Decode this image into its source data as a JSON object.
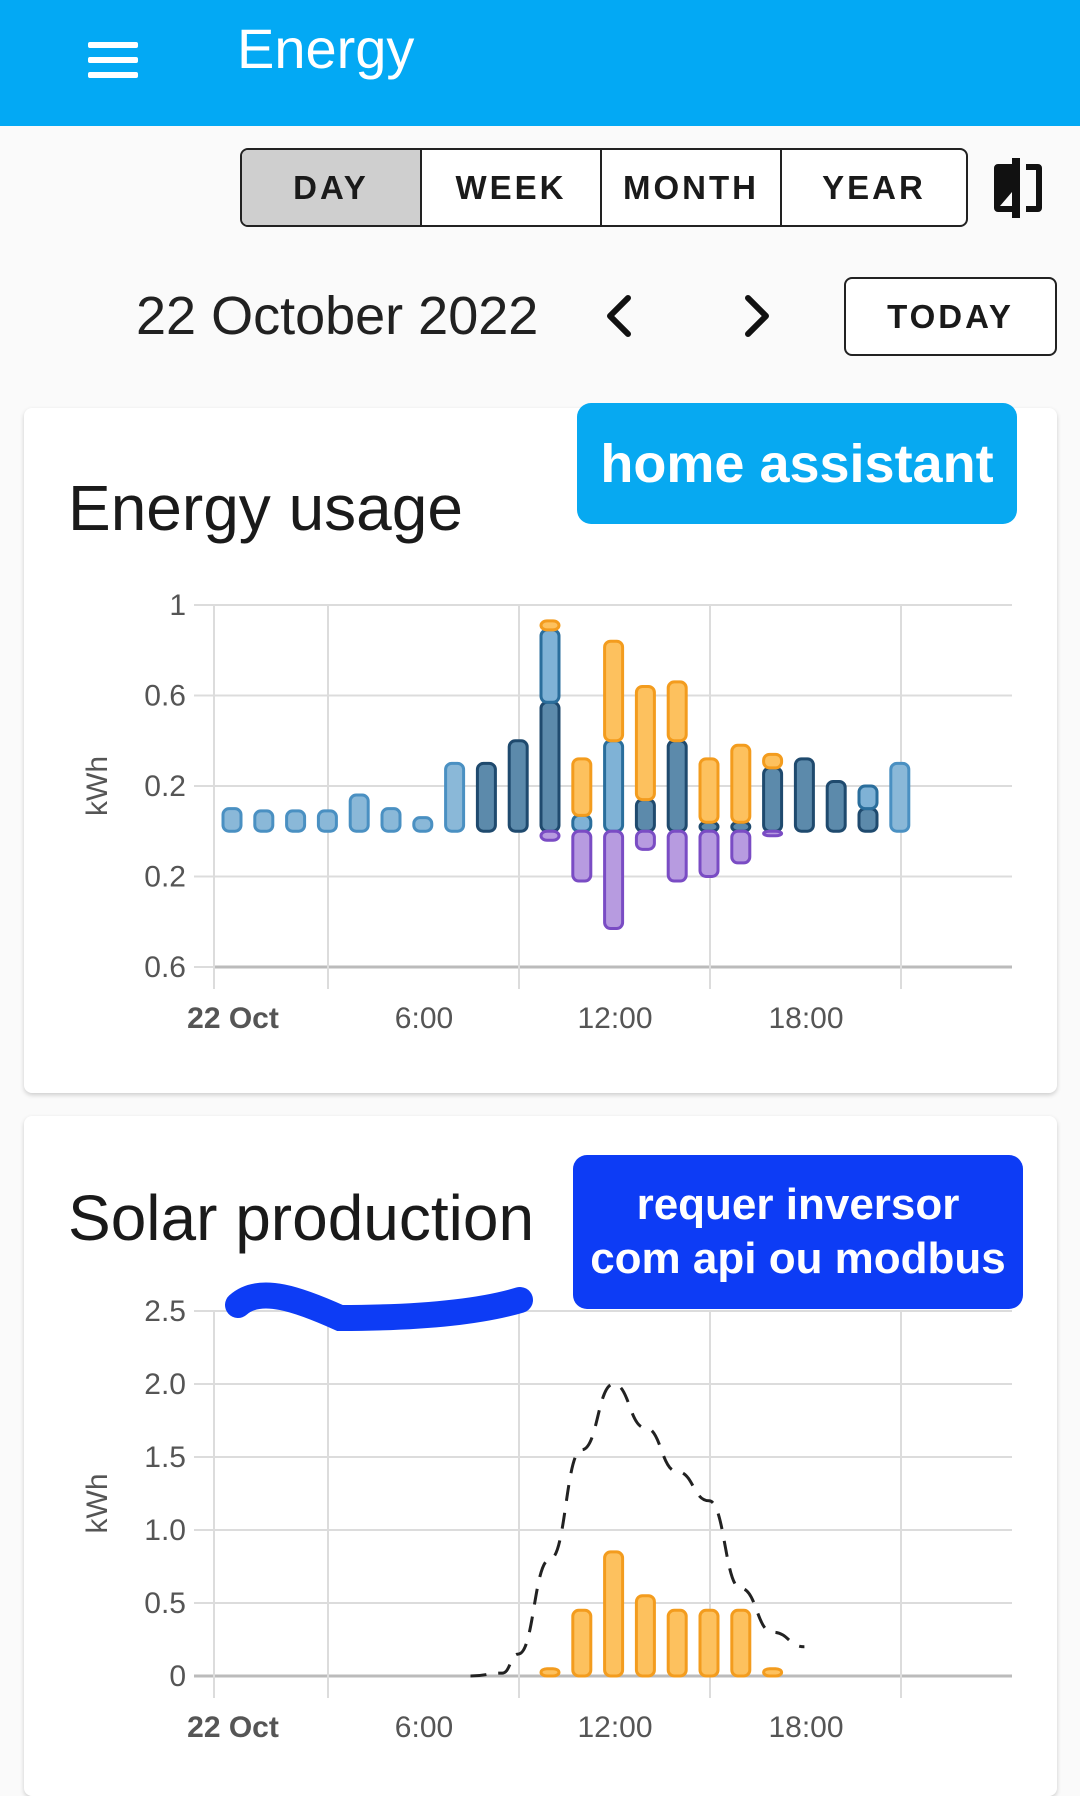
{
  "appbar": {
    "title": "Energy",
    "menu_icon": "menu-icon",
    "color": "#03a9f4"
  },
  "period_selector": {
    "options": [
      "DAY",
      "WEEK",
      "MONTH",
      "YEAR"
    ],
    "selected": "DAY",
    "compare_icon": "compare-icon"
  },
  "date_nav": {
    "date": "22 October 2022",
    "prev_icon": "chevron-left-icon",
    "next_icon": "chevron-right-icon",
    "today_label": "TODAY"
  },
  "annotations": {
    "sticker1": "home assistant",
    "sticker2_line1": "requer inversor",
    "sticker2_line2": "com api ou modbus"
  },
  "cards": {
    "usage_title": "Energy usage",
    "solar_title": "Solar production"
  },
  "chart_data": [
    {
      "type": "bar",
      "title": "Energy usage",
      "ylabel": "kWh",
      "y_tick_labels": [
        "1",
        "0.6",
        "0.2",
        "0.2",
        "0.6"
      ],
      "x_tick_labels": [
        "22 Oct",
        "6:00",
        "12:00",
        "18:00"
      ],
      "ylim": [
        -0.6,
        1.0
      ],
      "grid": true,
      "categories": [
        "0:00",
        "1:00",
        "2:00",
        "3:00",
        "4:00",
        "5:00",
        "6:00",
        "7:00",
        "8:00",
        "9:00",
        "10:00",
        "11:00",
        "12:00",
        "13:00",
        "14:00",
        "15:00",
        "16:00",
        "17:00",
        "18:00",
        "19:00",
        "20:00",
        "21:00"
      ],
      "series": [
        {
          "color": "#8ab8d8",
          "stroke": "#4a90c2",
          "values": [
            0.1,
            0.09,
            0.09,
            0.09,
            0.16,
            0.1,
            0.06,
            0.3,
            0,
            0,
            0,
            0,
            0,
            0,
            0,
            0,
            0,
            0,
            0,
            0,
            0,
            0.3
          ]
        },
        {
          "color": "#5c8aab",
          "stroke": "#1f4a6e",
          "values": [
            0,
            0,
            0,
            0,
            0,
            0,
            0,
            0,
            0.3,
            0.4,
            0.57,
            0,
            0,
            0.14,
            0.4,
            0.04,
            0.04,
            0.28,
            0.32,
            0.22,
            0.1,
            0
          ]
        },
        {
          "color": "#7fb2d6",
          "stroke": "#2a6e9c",
          "values": [
            0,
            0,
            0,
            0,
            0,
            0,
            0,
            0,
            0,
            0,
            0.32,
            0.07,
            0.4,
            0,
            0,
            0,
            0,
            0,
            0,
            0,
            0.1,
            0
          ]
        },
        {
          "color": "#fdc15e",
          "stroke": "#f39c1e",
          "values": [
            0,
            0,
            0,
            0,
            0,
            0,
            0,
            0,
            0,
            0,
            0.04,
            0.25,
            0.44,
            0.5,
            0.26,
            0.28,
            0.34,
            0.06,
            0,
            0,
            0,
            0
          ]
        },
        {
          "color": "#b79be0",
          "stroke": "#7a4cc4",
          "values": [
            0,
            0,
            0,
            0,
            0,
            0,
            0,
            0,
            0,
            0,
            -0.04,
            -0.22,
            -0.43,
            -0.08,
            -0.22,
            -0.2,
            -0.14,
            -0.02,
            0,
            0,
            0,
            0
          ]
        }
      ]
    },
    {
      "type": "bar",
      "title": "Solar production",
      "ylabel": "kWh",
      "y_tick_labels": [
        "2.5",
        "2.0",
        "1.5",
        "1.0",
        "0.5",
        "0"
      ],
      "x_tick_labels": [
        "22 Oct",
        "6:00",
        "12:00",
        "18:00"
      ],
      "ylim": [
        0,
        2.5
      ],
      "grid": true,
      "categories": [
        "10:00",
        "11:00",
        "12:00",
        "13:00",
        "14:00",
        "15:00",
        "16:00",
        "17:00"
      ],
      "values": [
        0.05,
        0.45,
        0.85,
        0.55,
        0.45,
        0.45,
        0.45,
        0.05
      ],
      "bar_color": "#fdc15e",
      "bar_stroke": "#f39c1e",
      "forecast": {
        "style": "dashed",
        "color": "#222222",
        "x": [
          7.5,
          8.5,
          9,
          10,
          11,
          12,
          13,
          14,
          15,
          16,
          17,
          18
        ],
        "y": [
          0,
          0.02,
          0.15,
          0.8,
          1.55,
          2.0,
          1.7,
          1.4,
          1.2,
          0.6,
          0.3,
          0.2
        ]
      }
    }
  ]
}
